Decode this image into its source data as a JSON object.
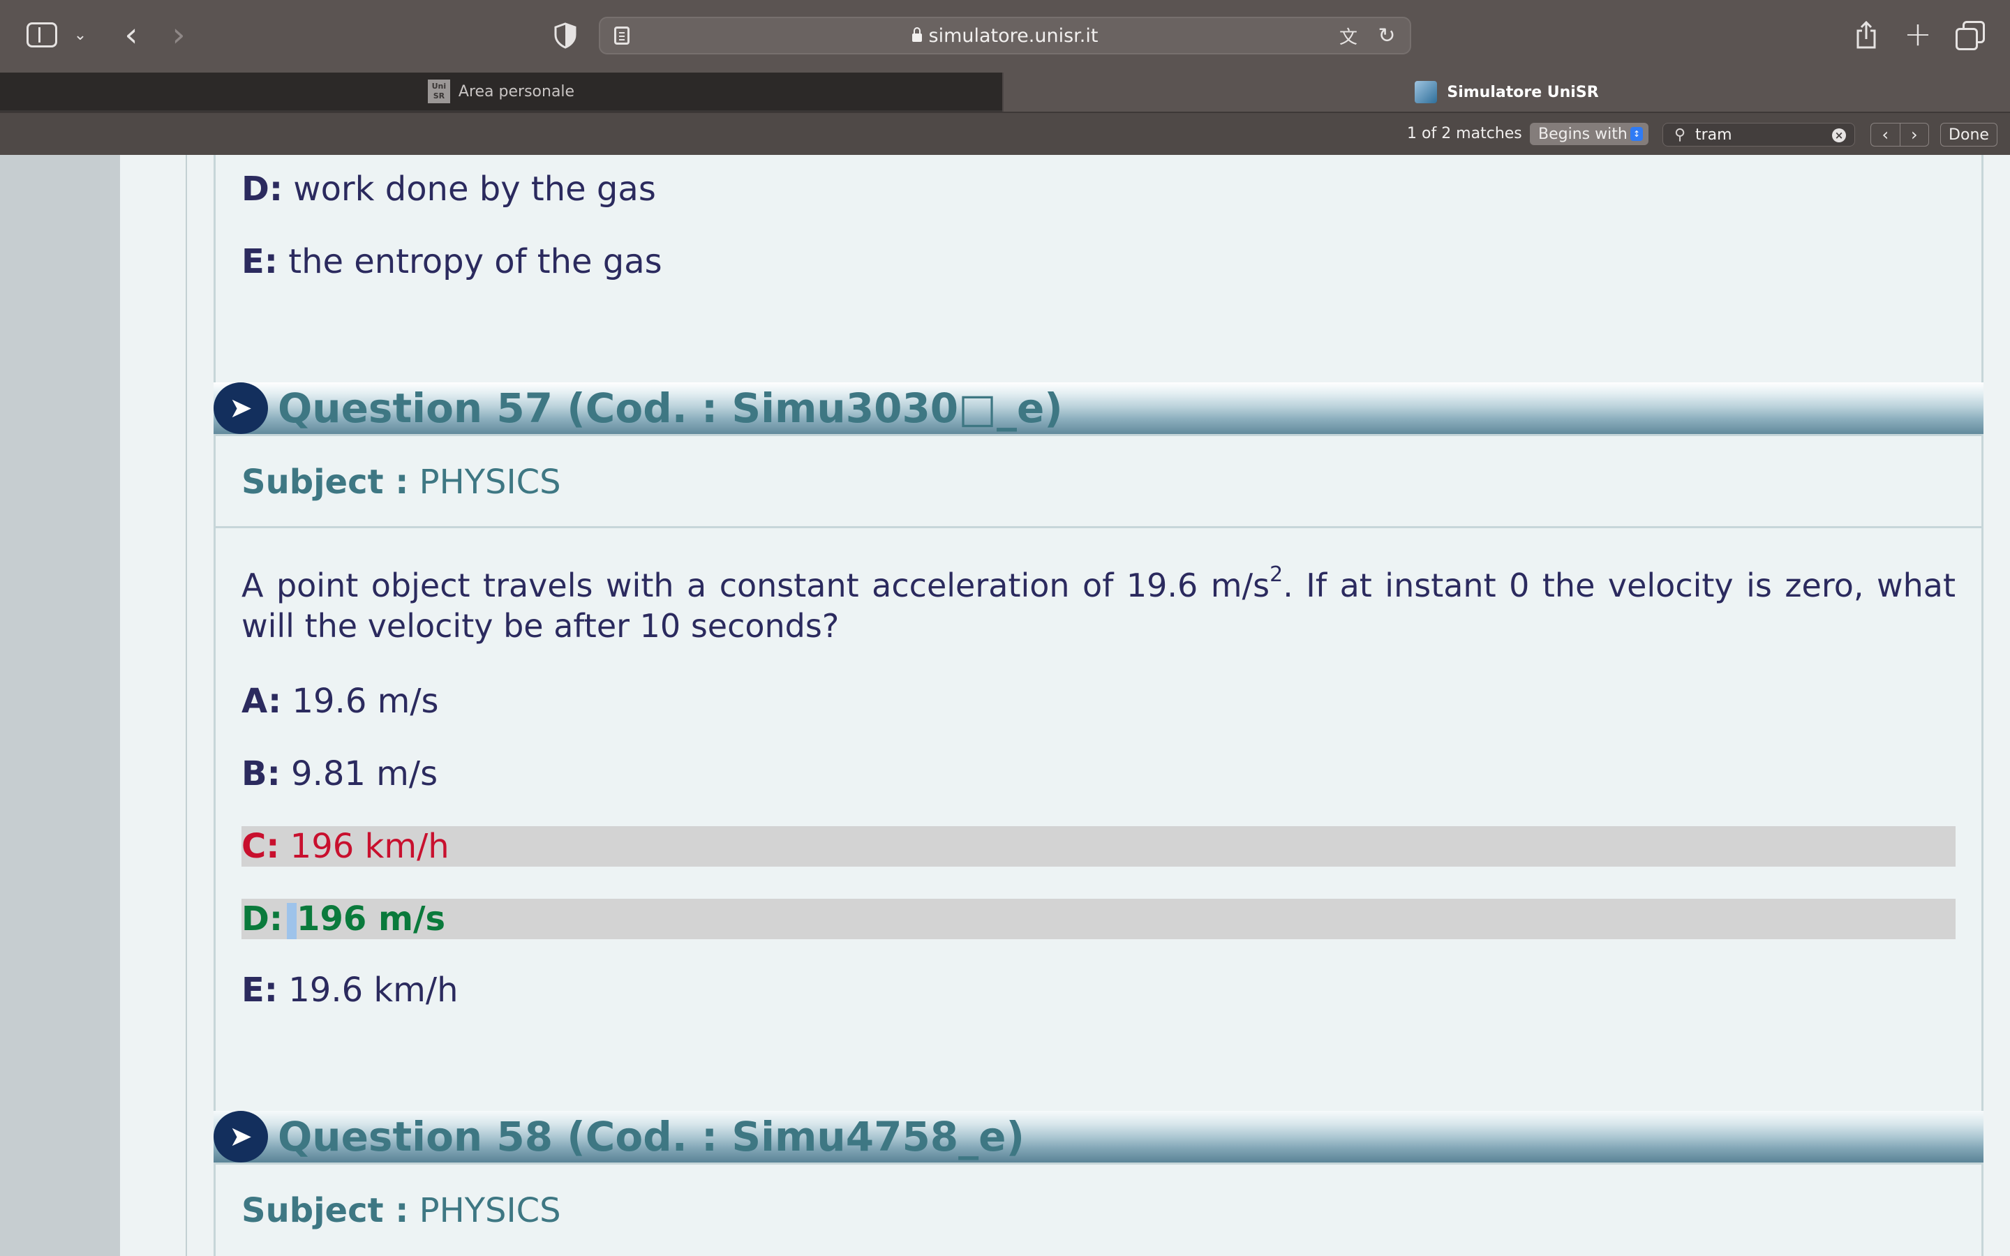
{
  "browser": {
    "url": "simulatore.unisr.it",
    "tabs": [
      {
        "label": "Area personale",
        "favicon": "unisr-favicon",
        "active": false
      },
      {
        "label": "Simulatore UniSR",
        "favicon": "globe-favicon",
        "active": true
      }
    ],
    "find": {
      "match_count": "1 of 2 matches",
      "mode": "Begins with",
      "query": "tram",
      "done_label": "Done"
    },
    "favicon_text": "Uni SR"
  },
  "prev_question": {
    "answers": [
      {
        "letter": "D:",
        "text": " work done by the gas"
      },
      {
        "letter": "E:",
        "text": " the entropy of the gas"
      }
    ]
  },
  "q57": {
    "title": "Question 57 (Cod. : Simu3030□_e)",
    "subject_label": "Subject :",
    "subject_value": " PHYSICS",
    "text_before_sup": "A point object travels with a constant acceleration of 19.6 m/s",
    "sup": "2",
    "text_after_sup": ". If at instant 0 the velocity is zero, what will the velocity be after 10 seconds?",
    "answers": [
      {
        "letter": "A:",
        "text": " 19.6 m/s"
      },
      {
        "letter": "B:",
        "text": " 9.81 m/s"
      },
      {
        "letter": "C:",
        "text": " 196 km/h"
      },
      {
        "letter": "D:",
        "text": "196 m/s"
      },
      {
        "letter": "E:",
        "text": " 19.6 km/h"
      }
    ]
  },
  "q58": {
    "title": "Question 58 (Cod. : Simu4758_e)",
    "subject_label": "Subject :",
    "subject_value": " PHYSICS"
  },
  "colors": {
    "wrong": "#c8102e",
    "correct": "#0a7a3c",
    "title": "#3e7783",
    "text": "#2b2a5e"
  }
}
